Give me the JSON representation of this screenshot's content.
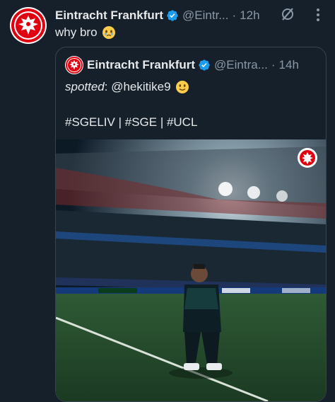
{
  "tweet": {
    "author_name": "Eintracht Frankfurt",
    "handle": "@Eintr...",
    "separator": "·",
    "time": "12h",
    "text": "why bro"
  },
  "quote": {
    "author_name": "Eintracht Frankfurt",
    "handle": "@Eintra...",
    "separator": "·",
    "time": "14h",
    "text_italic": "spotted",
    "text_rest": ": @hekitike9",
    "hashtags": "#SGELIV | #SGE | #UCL"
  },
  "icons": {
    "verified": "verified-badge-icon",
    "grok": "grok-icon",
    "more": "more-options-icon",
    "emoji_tweet": "face-holding-back-tears-emoji",
    "emoji_quote": "slightly-smiling-face-emoji"
  },
  "colors": {
    "background": "#15202b",
    "text": "#e7e9ea",
    "muted": "#8b98a5",
    "verified": "#1d9bf0",
    "border": "#38444d",
    "brand_red": "#e1000f"
  }
}
